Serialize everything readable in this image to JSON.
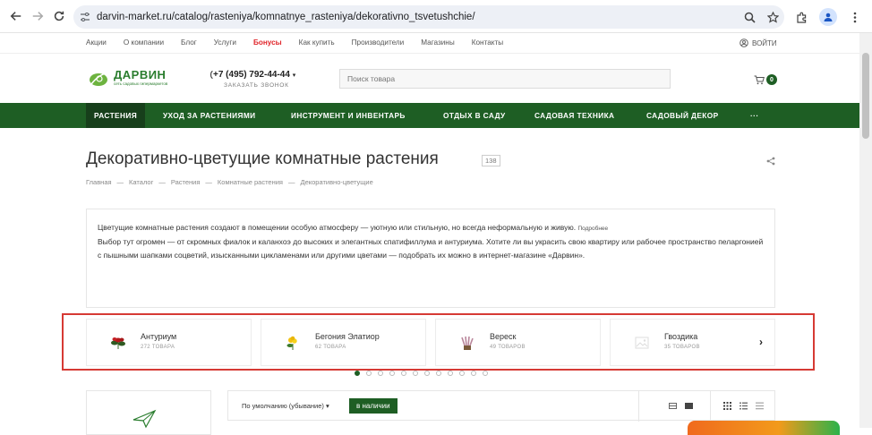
{
  "browser": {
    "url": "darvin-market.ru/catalog/rasteniya/komnatnye_rasteniya/dekorativno_tsvetushchie/"
  },
  "topbar": {
    "links": [
      "Акции",
      "О компании",
      "Блог",
      "Услуги",
      "Бонусы",
      "Как купить",
      "Производители",
      "Магазины",
      "Контакты"
    ],
    "login": "ВОЙТИ"
  },
  "header": {
    "logo_name": "ДАРВИН",
    "logo_tag": "сеть садовых гипермаркетов",
    "phone": "+7 (495) 792-44-44",
    "callback": "ЗАКАЗАТЬ ЗВОНОК",
    "search_placeholder": "Поиск товара",
    "cart_count": "0"
  },
  "mainnav": {
    "items": [
      "РАСТЕНИЯ",
      "УХОД ЗА РАСТЕНИЯМИ",
      "ИНСТРУМЕНТ И ИНВЕНТАРЬ",
      "ОТДЫХ В САДУ",
      "САДОВАЯ ТЕХНИКА",
      "САДОВЫЙ ДЕКОР",
      "···"
    ]
  },
  "page": {
    "title": "Декоративно-цветущие комнатные растения",
    "count": "138",
    "breadcrumbs": [
      "Главная",
      "Каталог",
      "Растения",
      "Комнатные растения",
      "Декоративно-цветущие"
    ],
    "desc_line1": "Цветущие комнатные растения создают в помещении особую атмосферу — уютную или стильную, но всегда неформальную и живую.",
    "desc_more": "Подробнее",
    "desc_p2": "Выбор тут огромен — от скромных фиалок и каланхоэ до высоких и элегантных спатифиллума и антуриума. Хотите ли вы украсить свою квартиру или рабочее пространство пеларгонией с пышными шапками соцветий, изысканными цикламенами или другими цветами — подобрать их можно в интернет-магазине «Дарвин»."
  },
  "categories": [
    {
      "name": "Антуриум",
      "count": "272 ТОВАРА"
    },
    {
      "name": "Бегония Элатиор",
      "count": "62 ТОВАРА"
    },
    {
      "name": "Вереск",
      "count": "49 ТОВАРОВ"
    },
    {
      "name": "Гвоздика",
      "count": "35 ТОВАРОВ"
    }
  ],
  "slider": {
    "dots": 12,
    "active": 0
  },
  "toolbar": {
    "sort": "По умолчанию (убывание)",
    "instock": "в наличии"
  },
  "colors": {
    "brand_green": "#1e5e24",
    "highlight_red": "#d63a34",
    "bonus_red": "#e0262b"
  }
}
